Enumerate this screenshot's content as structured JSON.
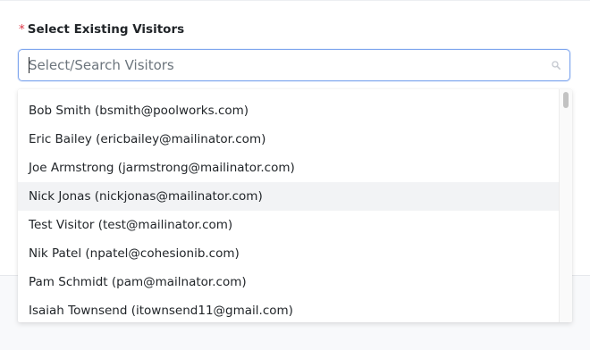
{
  "field": {
    "required_mark": "*",
    "label": "Select Existing Visitors"
  },
  "search": {
    "placeholder": "Select/Search Visitors",
    "value": "",
    "icon": "search-icon"
  },
  "dropdown": {
    "hovered_index": 3,
    "options": [
      {
        "label": "Bob Smith (bsmith@poolworks.com)"
      },
      {
        "label": "Eric Bailey (ericbailey@mailinator.com)"
      },
      {
        "label": "Joe Armstrong (jarmstrong@mailinator.com)"
      },
      {
        "label": "Nick Jonas (nickjonas@mailinator.com)"
      },
      {
        "label": "Test Visitor (test@mailinator.com)"
      },
      {
        "label": "Nik Patel (npatel@cohesionib.com)"
      },
      {
        "label": "Pam Schmidt (pam@mailnator.com)"
      },
      {
        "label": "Isaiah Townsend (itownsend11@gmail.com)"
      }
    ]
  },
  "colors": {
    "required": "#dc3545",
    "focus_border": "#7fa6ee",
    "hover_row": "#f2f3f5",
    "text": "#212529"
  }
}
